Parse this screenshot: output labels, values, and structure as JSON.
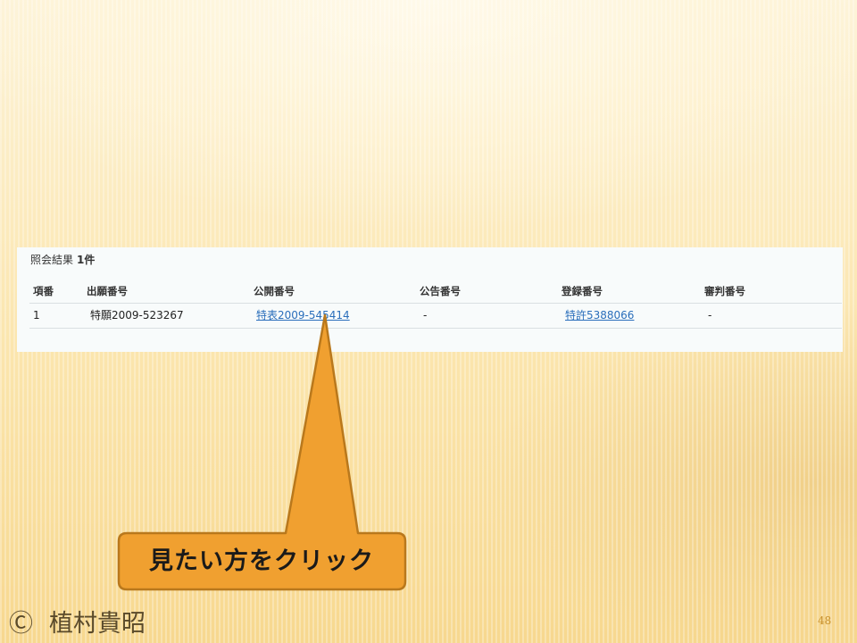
{
  "result": {
    "summary_label": "照会結果",
    "count": "1件"
  },
  "table": {
    "headers": [
      "項番",
      "出願番号",
      "公開番号",
      "公告番号",
      "登録番号",
      "審判番号"
    ],
    "rows": [
      {
        "index": "1",
        "application_number": "特願2009-523267",
        "publication_number": "特表2009-545414",
        "announcement_number": "-",
        "registration_number": "特許5388066",
        "appeal_number": "-"
      }
    ]
  },
  "callout": {
    "text": "見たい方をクリック",
    "fill_color": "#f0a030",
    "border_color": "#b9781c"
  },
  "footer": {
    "copyright_mark": "Ⓒ",
    "author": "植村貴昭",
    "page_number": "48"
  }
}
